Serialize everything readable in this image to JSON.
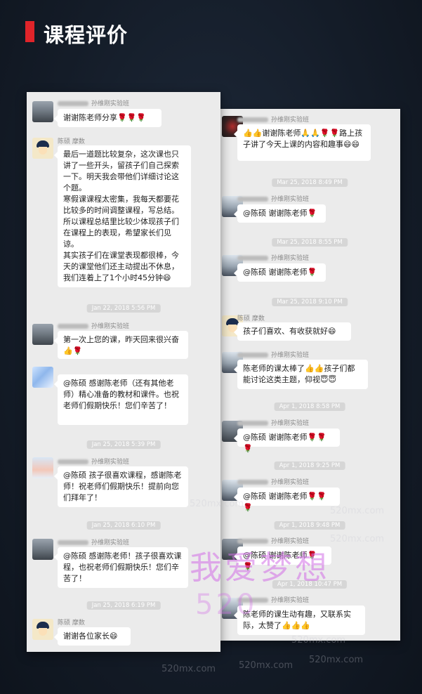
{
  "header": {
    "title": "课程评价"
  },
  "left_panel": {
    "messages": [
      {
        "sender": "孙维刚实验班",
        "text": "谢谢陈老师分享🌹🌹🌹"
      },
      {
        "sender": "陈硕 摩数",
        "text": "最后一道题比较复杂，这次课也只讲了一些开头，留孩子们自己探索一下。明天我会带他们详细讨论这个题。\n寒假课课程太密集，我每天都要花比较多的时间调整课程，写总结。所以课程总结里比较少体现孩子们在课程上的表现，希望家长们见谅。\n其实孩子们在课堂表现都很棒，今天的课堂他们还主动提出不休息，我们连着上了1个小时45分钟😄"
      },
      {
        "timestamp": "Jan 22, 2018 5:56 PM"
      },
      {
        "sender": "孙维刚实验班",
        "text": "第一次上您的课，昨天回来很兴奋👍🌹"
      },
      {
        "sender": "",
        "text": "@陈硕 感谢陈老师（还有其他老师）精心准备的教材和课件。也祝老师们假期快乐！您们辛苦了！"
      },
      {
        "timestamp": "Jan 25, 2018 5:39 PM"
      },
      {
        "sender": "孙维刚实验班",
        "text": "@陈硕 孩子很喜欢课程，感谢陈老师！祝老师们假期快乐！提前向您们拜年了！"
      },
      {
        "timestamp": "Jan 25, 2018 6:10 PM"
      },
      {
        "sender": "孙维刚实验班",
        "text": "@陈硕 感谢陈老师！孩子很喜欢课程，也祝老师们假期快乐！您们辛苦了！"
      },
      {
        "timestamp": "Jan 25, 2018 6:19 PM"
      },
      {
        "sender": "陈硕 摩数",
        "text": "谢谢各位家长😄"
      }
    ]
  },
  "right_panel": {
    "messages": [
      {
        "sender": "孙维刚实验班",
        "text": "👍👍谢谢陈老师🙏🙏🌹🌹路上孩子讲了今天上课的内容和趣事😄😄"
      },
      {
        "timestamp": "Mar 25, 2018 8:49 PM"
      },
      {
        "sender": "孙维刚实验班",
        "text": "@陈硕 谢谢陈老师🌹"
      },
      {
        "timestamp": "Mar 25, 2018 8:55 PM"
      },
      {
        "sender": "孙维刚实验班",
        "text": "@陈硕 谢谢陈老师🌹"
      },
      {
        "timestamp": "Mar 25, 2018 9:10 PM"
      },
      {
        "sender": "陈硕 摩数",
        "text": "孩子们喜欢、有收获就好😄"
      },
      {
        "sender": "孙维刚实验班",
        "text": "陈老师的课太棒了👍👍孩子们都能讨论这类主题，仰视😇😇"
      },
      {
        "timestamp": "Apr 1, 2018 8:58 PM"
      },
      {
        "sender": "孙维刚实验班",
        "text": "@陈硕 谢谢陈老师🌹🌹🌹"
      },
      {
        "timestamp": "Apr 1, 2018 9:25 PM"
      },
      {
        "sender": "孙维刚实验班",
        "text": "@陈硕 谢谢陈老师🌹🌹🌹"
      },
      {
        "timestamp": "Apr 1, 2018 9:48 PM"
      },
      {
        "sender": "孙维刚实验班",
        "text": "@陈硕 谢谢陈老师🌹🌹"
      },
      {
        "timestamp": "Apr 1, 2018 10:47 PM"
      },
      {
        "sender": "孙维刚实验班",
        "text": "陈老师的课生动有趣，又联系实际，太赞了👍👍👍"
      }
    ]
  },
  "watermark": {
    "brand": "我爱梦想",
    "domain_big": "520",
    "domain_small": "520mx.com"
  },
  "colors": {
    "accent": "#e0242a",
    "background": "#1a2433",
    "panel": "#ebebeb",
    "bubble": "#ffffff"
  }
}
